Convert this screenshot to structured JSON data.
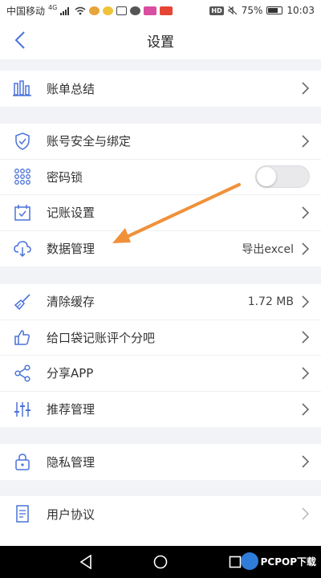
{
  "status_bar": {
    "carrier": "中国移动",
    "network": "4G",
    "battery_percent": "75%",
    "battery_level": 0.75,
    "time": "10:03",
    "hd": "HD"
  },
  "header": {
    "title": "设置"
  },
  "groups": [
    {
      "items": [
        {
          "label": "账单总结",
          "icon": "bar-chart-icon"
        }
      ]
    },
    {
      "items": [
        {
          "label": "账号安全与绑定",
          "icon": "shield-icon"
        },
        {
          "label": "密码锁",
          "icon": "keypad-icon",
          "toggle": false
        },
        {
          "label": "记账设置",
          "icon": "calendar-check-icon"
        },
        {
          "label": "数据管理",
          "icon": "cloud-download-icon",
          "value": "导出excel"
        }
      ]
    },
    {
      "items": [
        {
          "label": "清除缓存",
          "icon": "broom-icon",
          "value": "1.72 MB"
        },
        {
          "label": "给口袋记账评个分吧",
          "icon": "thumbs-up-icon"
        },
        {
          "label": "分享APP",
          "icon": "share-icon"
        },
        {
          "label": "推荐管理",
          "icon": "sliders-icon"
        }
      ]
    },
    {
      "items": [
        {
          "label": "隐私管理",
          "icon": "lock-icon"
        }
      ]
    },
    {
      "items": [
        {
          "label": "用户协议",
          "icon": "document-icon"
        }
      ]
    }
  ],
  "watermark": {
    "text": "PCPOP下载"
  },
  "colors": {
    "accent": "#4a72d9",
    "arrow": "#f0913a",
    "background": "#f2f3f7"
  }
}
